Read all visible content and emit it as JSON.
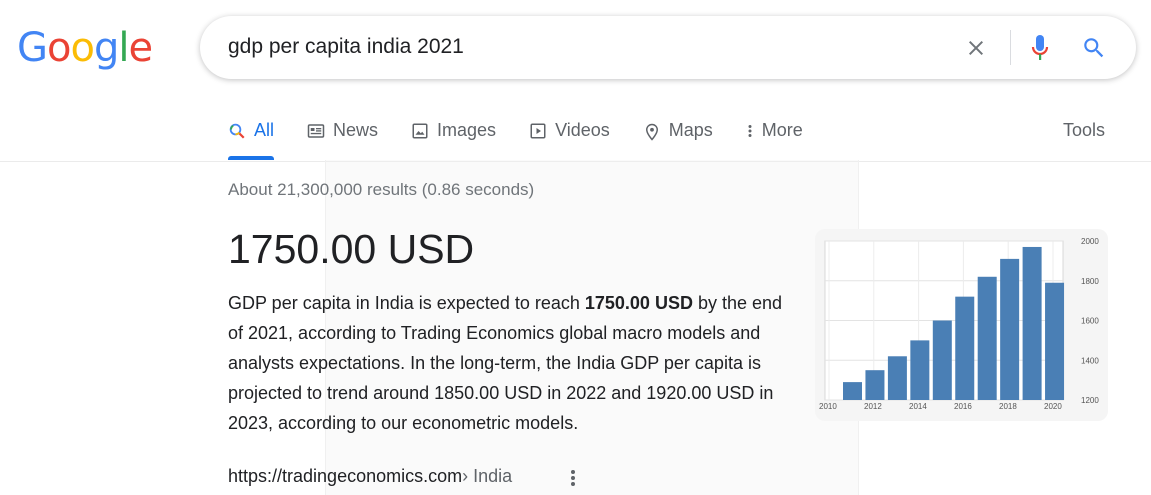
{
  "logo": {
    "letters": [
      "G",
      "o",
      "o",
      "g",
      "l",
      "e"
    ],
    "colors": [
      "#4285F4",
      "#EA4335",
      "#FBBC05",
      "#4285F4",
      "#34A853",
      "#EA4335"
    ]
  },
  "search": {
    "query": "gdp per capita india 2021",
    "clear_icon": "close-icon",
    "mic_icon": "mic-icon",
    "search_icon": "search-icon"
  },
  "tabs": [
    {
      "label": "All",
      "icon": "search-icon",
      "active": true
    },
    {
      "label": "News",
      "icon": "news-icon"
    },
    {
      "label": "Images",
      "icon": "image-icon"
    },
    {
      "label": "Videos",
      "icon": "video-icon"
    },
    {
      "label": "Maps",
      "icon": "map-pin-icon"
    },
    {
      "label": "More",
      "icon": "more-vert-icon"
    }
  ],
  "tools_label": "Tools",
  "results_count": "About 21,300,000 results (0.86 seconds)",
  "answer": "1750.00 USD",
  "snippet": {
    "before": "GDP per capita in India is expected to reach ",
    "bold": "1750.00 USD",
    "after": " by the end of 2021, according to Trading Economics global macro models and analysts expectations. In the long-term, the India GDP per capita is projected to trend around 1850.00 USD in 2022 and 1920.00 USD in 2023, according to our econometric models."
  },
  "citation": {
    "domain": "https://tradingeconomics.com",
    "crumb": " › India"
  },
  "accent_color": "#1a73e8",
  "chart_data": {
    "type": "bar",
    "categories": [
      "2010",
      "2011",
      "2012",
      "2013",
      "2014",
      "2015",
      "2016",
      "2017",
      "2018",
      "2019",
      "2020"
    ],
    "x_tick_labels": [
      "2010",
      "2012",
      "2014",
      "2016",
      "2018",
      "2020"
    ],
    "values": [
      1290,
      1350,
      1420,
      1500,
      1600,
      1720,
      1820,
      1910,
      1970,
      1790
    ],
    "bar_years": [
      "2011",
      "2012",
      "2013",
      "2014",
      "2015",
      "2016",
      "2017",
      "2018",
      "2019",
      "2020"
    ],
    "y_tick_labels": [
      "2000",
      "1800",
      "1600",
      "1400",
      "1200"
    ],
    "ylim": [
      1200,
      2000
    ],
    "grid": true,
    "bar_color": "#4a7fb5"
  }
}
